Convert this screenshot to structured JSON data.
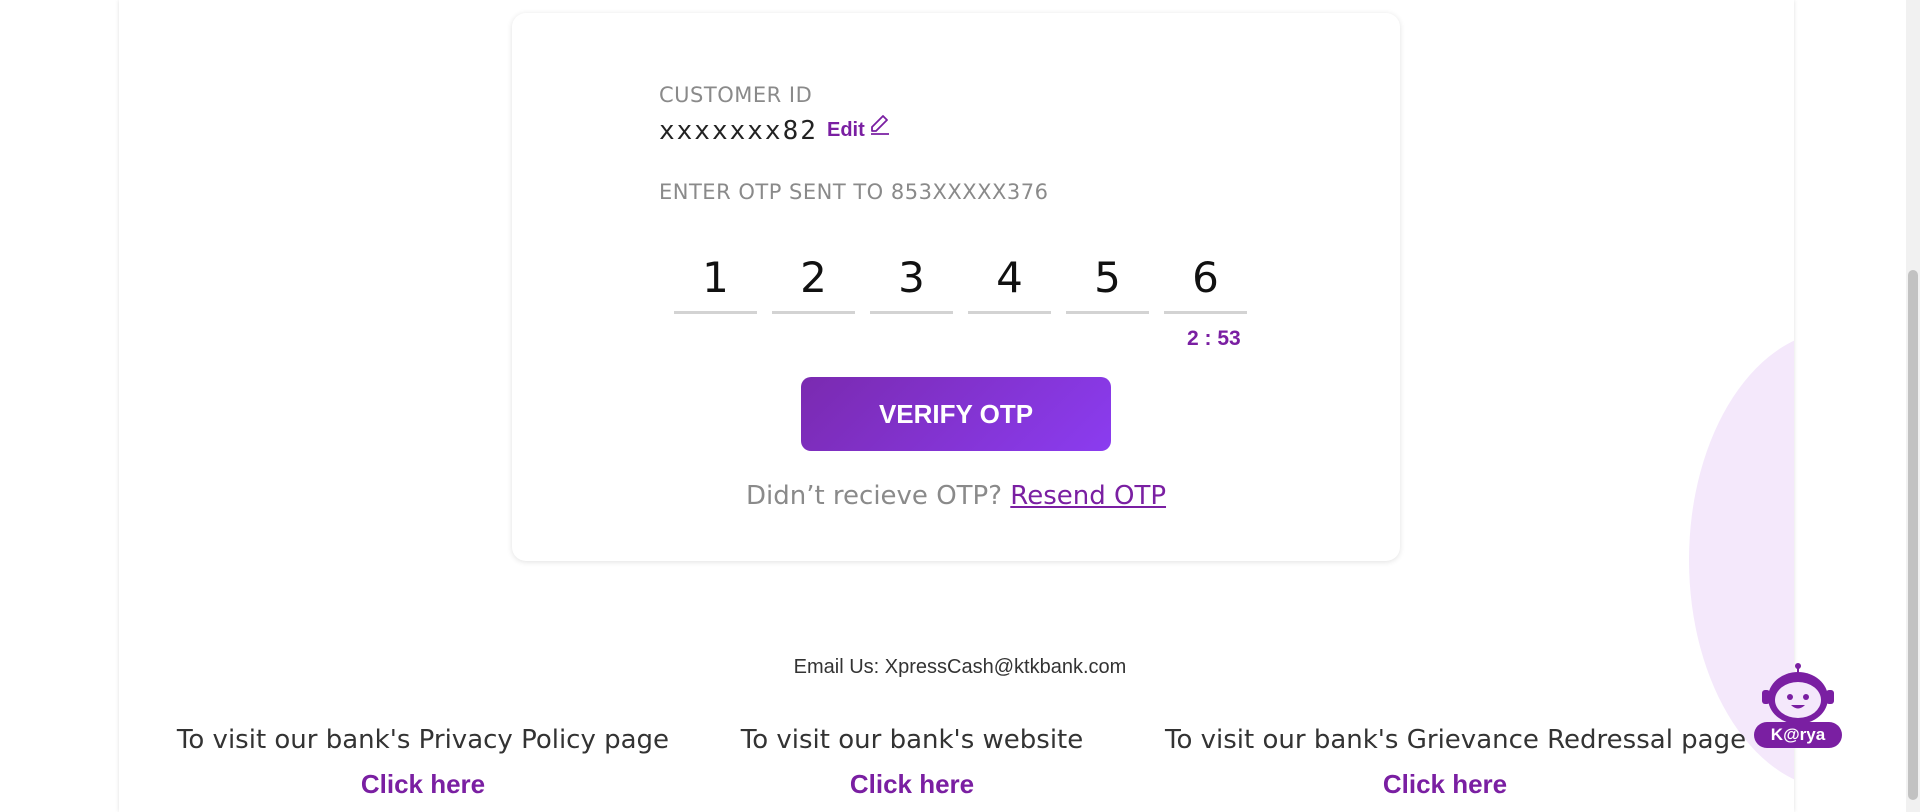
{
  "card": {
    "customer_id_label": "CUSTOMER ID",
    "customer_id_value": "xxxxxxx82",
    "edit_label": "Edit",
    "otp_label": "ENTER OTP SENT TO 853XXXXX376",
    "otp_digits": [
      "1",
      "2",
      "3",
      "4",
      "5",
      "6"
    ],
    "timer": "2 : 53",
    "verify_button": "VERIFY OTP",
    "resend_prompt": "Didn’t recieve OTP?",
    "resend_link": "Resend OTP"
  },
  "footer": {
    "email": "Email Us: XpressCash@ktkbank.com",
    "links": [
      {
        "text": "To visit our bank's Privacy Policy page",
        "link": "Click here"
      },
      {
        "text": "To visit our bank's website",
        "link": "Click here"
      },
      {
        "text": "To visit our bank's Grievance Redressal page",
        "link": "Click here"
      }
    ]
  },
  "chatbot": {
    "label": "K@rya",
    "icon": "robot-icon"
  },
  "colors": {
    "accent": "#7a1fa2",
    "button_gradient_start": "#7a2ab0",
    "button_gradient_end": "#8b3cf0"
  }
}
